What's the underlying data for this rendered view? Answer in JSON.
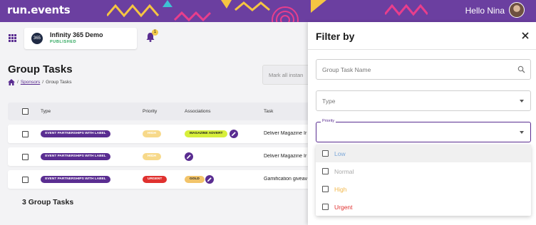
{
  "app": {
    "logo_text": "run.events",
    "greeting": "Hello Nina"
  },
  "event": {
    "name": "Infinity 365 Demo",
    "status": "PUBLISHED",
    "logo_text": "365"
  },
  "notifications": {
    "count": "1"
  },
  "page": {
    "title": "Group Tasks",
    "breadcrumb": {
      "link": "Sponsors",
      "separator": "/",
      "current": "Group Tasks"
    },
    "mark_all_label": "Mark all instan"
  },
  "table": {
    "headers": {
      "type": "Type",
      "priority": "Priority",
      "associations": "Associations",
      "task": "Task"
    },
    "rows": [
      {
        "type": "EVENT PARTNERSHIPS WITH LABEL",
        "priority": "HIGH",
        "priority_color": "#f7d98a",
        "association": "MAGAZINE ADVERT",
        "association_color": "#d7ef3a",
        "task": "Deliver Magazine Ir"
      },
      {
        "type": "EVENT PARTNERSHIPS WITH LABEL",
        "priority": "HIGH",
        "priority_color": "#f7d98a",
        "association": "",
        "association_color": "",
        "task": "Deliver Magazine Ir"
      },
      {
        "type": "EVENT PARTNERSHIPS WITH LABEL",
        "priority": "URGENT",
        "priority_color": "#e0312f",
        "association": "GOLD",
        "association_color": "#f2c46a",
        "task": "Gamification giveav"
      }
    ]
  },
  "summary": {
    "count_label": "3 Group Tasks"
  },
  "filter": {
    "title": "Filter by",
    "name_placeholder": "Group Task Name",
    "type_placeholder": "Type",
    "priority_label": "Priority",
    "options": [
      {
        "label": "Low",
        "color": "#7aa7d8"
      },
      {
        "label": "Normal",
        "color": "#a9a9a9"
      },
      {
        "label": "High",
        "color": "#f2b84b"
      },
      {
        "label": "Urgent",
        "color": "#e0312f"
      }
    ]
  },
  "colors": {
    "brand": "#6b3fa0",
    "accent": "#5a2d91"
  }
}
